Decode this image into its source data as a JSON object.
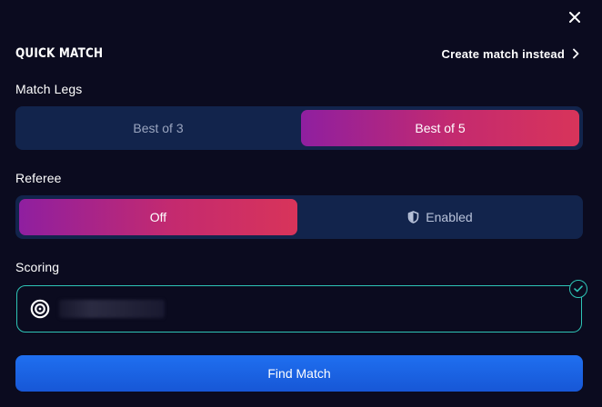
{
  "dialog": {
    "title": "QUICK MATCH",
    "create_link_label": "Create match instead"
  },
  "match_legs": {
    "label": "Match Legs",
    "options": [
      "Best of 3",
      "Best of 5"
    ],
    "selected": "Best of 5"
  },
  "referee": {
    "label": "Referee",
    "options": [
      "Off",
      "Enabled"
    ],
    "selected": "Off"
  },
  "scoring": {
    "label": "Scoring",
    "status": "valid"
  },
  "actions": {
    "find_match_label": "Find Match"
  },
  "colors": {
    "background": "#0b0b1f",
    "segment_track": "#12244c",
    "active_gradient_start": "#8f1fa0",
    "active_gradient_end": "#d8345a",
    "accent_teal": "#2ec4b6",
    "primary_button": "#1f6ff0"
  },
  "icons": {
    "close": "close-icon",
    "chevron": "chevron-right-icon",
    "shield": "shield-icon",
    "target": "target-icon",
    "check": "check-icon"
  }
}
